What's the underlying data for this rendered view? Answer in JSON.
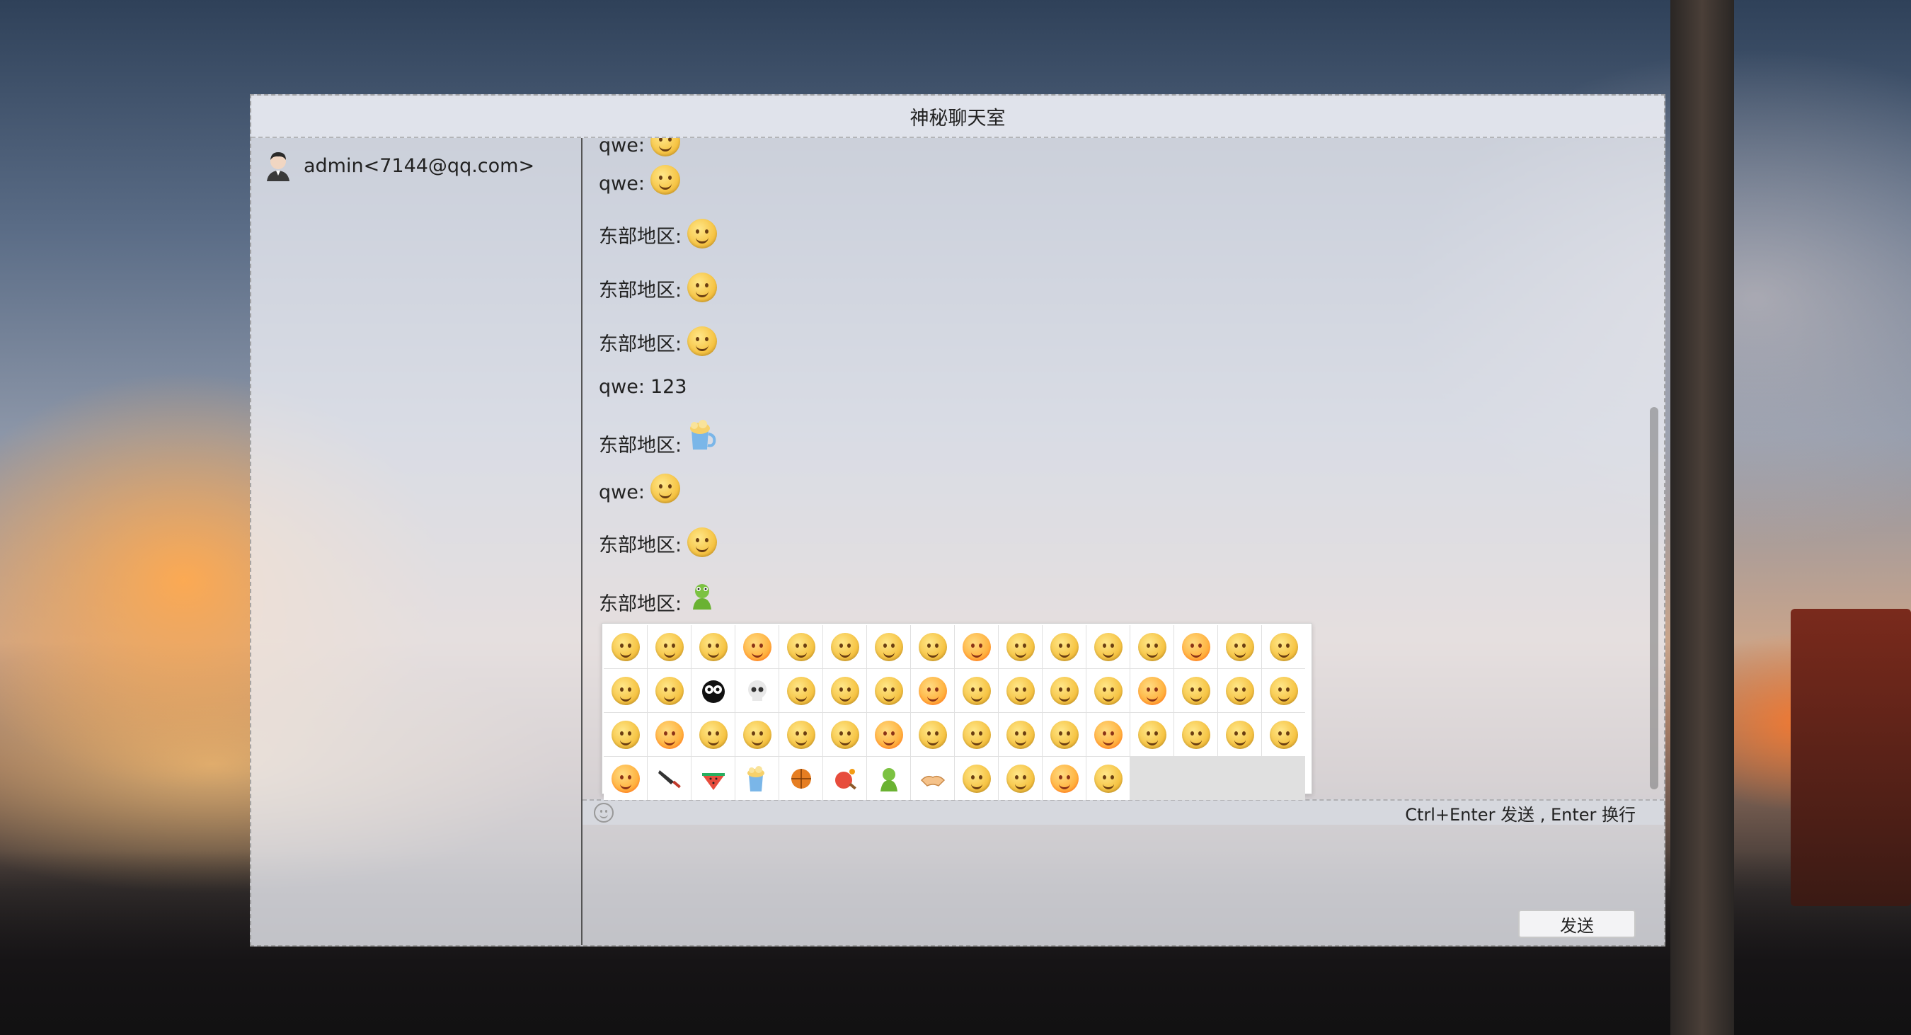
{
  "window": {
    "title": "神秘聊天室"
  },
  "sidebar": {
    "users": [
      {
        "label": "admin<7144@qq.com>"
      }
    ]
  },
  "messages": [
    {
      "sender": "qwe:",
      "text": "",
      "emoji": "smile-emoji",
      "partial": true
    },
    {
      "sender": "qwe:",
      "text": "",
      "emoji": "sleepy-emoji"
    },
    {
      "sender": "东部地区:",
      "text": "",
      "emoji": "grin-emoji"
    },
    {
      "sender": "东部地区:",
      "text": "",
      "emoji": "laugh-emoji"
    },
    {
      "sender": "东部地区:",
      "text": "",
      "emoji": "smirk-emoji"
    },
    {
      "sender": "qwe:",
      "text": "123",
      "emoji": ""
    },
    {
      "sender": "东部地区:",
      "text": "",
      "emoji": "beer-emoji"
    },
    {
      "sender": "qwe:",
      "text": "",
      "emoji": "sad-emoji"
    },
    {
      "sender": "东部地区:",
      "text": "",
      "emoji": "sad-emoji"
    },
    {
      "sender": "东部地区:",
      "text": "",
      "emoji": "frog-emoji"
    }
  ],
  "toolbar": {
    "hint": "Ctrl+Enter 发送 , Enter 换行"
  },
  "input": {
    "send_label": "发送"
  },
  "emoji_picker": {
    "rows": 4,
    "columns": 16,
    "count": 60
  },
  "colors": {
    "window_bg": "#eceef4",
    "emoji_yellow": "#f6c445",
    "divider": "#555555"
  }
}
